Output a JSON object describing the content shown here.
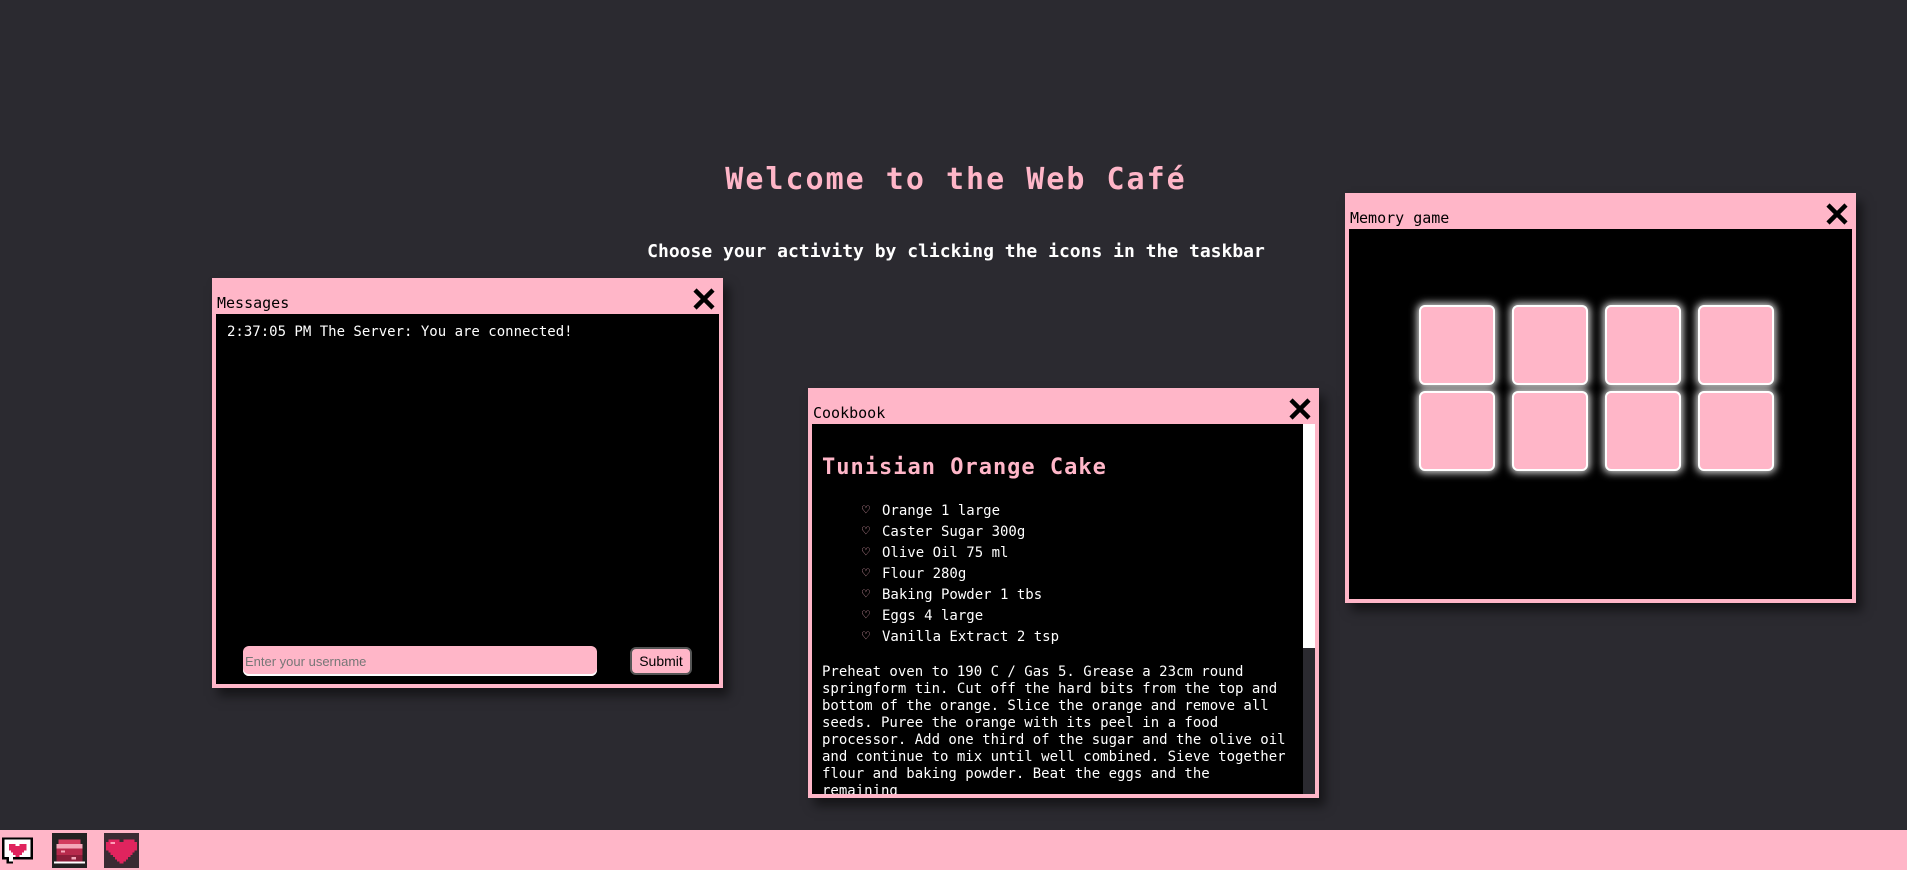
{
  "welcome": {
    "title": "Welcome to the Web Café",
    "subtitle": "Choose your activity by clicking the icons in the taskbar"
  },
  "messages": {
    "title": "Messages",
    "log": [
      "2:37:05 PM The Server: You are connected!"
    ],
    "username_placeholder": "Enter your username",
    "submit_label": "Submit"
  },
  "cookbook": {
    "title": "Cookbook",
    "recipe_title": "Tunisian Orange Cake",
    "ingredients": [
      "Orange 1 large",
      "Caster Sugar 300g",
      "Olive Oil 75 ml",
      "Flour 280g",
      "Baking Powder 1 tbs",
      "Eggs 4 large",
      "Vanilla Extract 2 tsp"
    ],
    "method": "Preheat oven to 190 C / Gas 5. Grease a 23cm round springform tin. Cut off the hard bits from the top and bottom of the orange. Slice the orange and remove all seeds. Puree the orange with its peel in a food processor. Add one third of the sugar and the olive oil and continue to mix until well combined. Sieve together flour and baking powder. Beat the eggs and the remaining"
  },
  "memory_game": {
    "title": "Memory game",
    "card_count": 8
  },
  "taskbar": {
    "icons": [
      "chat-bubble-heart-icon",
      "cake-icon",
      "heart-icon"
    ]
  },
  "colors": {
    "background": "#2b2a30",
    "accent_pink": "#ffb6c8",
    "window_body": "#000000",
    "heart_red": "#e0245e"
  }
}
